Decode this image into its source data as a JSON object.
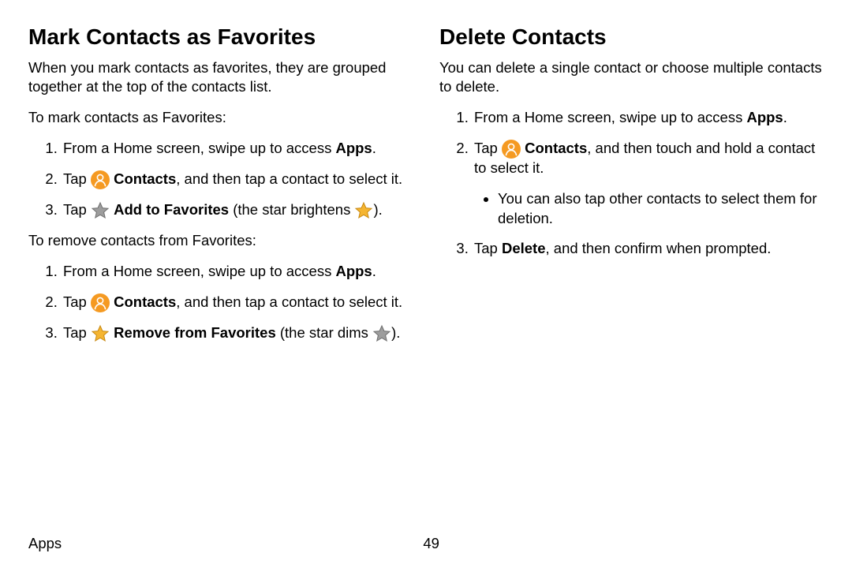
{
  "left": {
    "heading": "Mark Contacts as Favorites",
    "intro": "When you mark contacts as favorites, they are grouped together at the top of the contacts list.",
    "mark_lead": "To mark contacts as Favorites:",
    "mark_steps": {
      "s1_a": "From a Home screen, swipe up to access ",
      "s1_b": "Apps",
      "s1_c": ".",
      "s2_a": "Tap ",
      "s2_b": "Contacts",
      "s2_c": ", and then tap a contact to select it.",
      "s3_a": "Tap ",
      "s3_b": "Add to Favorites",
      "s3_c": " (the star brightens ",
      "s3_d": ")."
    },
    "remove_lead": "To remove contacts from Favorites:",
    "remove_steps": {
      "s1_a": "From a Home screen, swipe up to access ",
      "s1_b": "Apps",
      "s1_c": ".",
      "s2_a": "Tap ",
      "s2_b": "Contacts",
      "s2_c": ", and then tap a contact to select it.",
      "s3_a": "Tap ",
      "s3_b": "Remove from Favorites",
      "s3_c": " (the star dims ",
      "s3_d": ")."
    }
  },
  "right": {
    "heading": "Delete Contacts",
    "intro": "You can delete a single contact or choose multiple contacts to delete.",
    "steps": {
      "s1_a": "From a Home screen, swipe up to access ",
      "s1_b": "Apps",
      "s1_c": ".",
      "s2_a": "Tap ",
      "s2_b": "Contacts",
      "s2_c": ", and then touch and hold a contact to select it.",
      "s2_sub": "You can also tap other contacts to select them for deletion.",
      "s3_a": "Tap ",
      "s3_b": "Delete",
      "s3_c": ", and then confirm when prompted."
    }
  },
  "footer": {
    "section": "Apps",
    "page": "49"
  },
  "colors": {
    "orange": "#f59a22",
    "grey": "#9d9d9d",
    "yellow": "#f5b531"
  }
}
